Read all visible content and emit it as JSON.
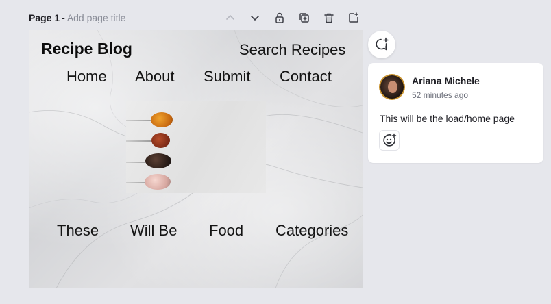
{
  "page": {
    "label": "Page 1",
    "separator": "-",
    "title_placeholder": "Add page title"
  },
  "toolbar": {
    "icons": [
      "chevron-up-icon",
      "chevron-down-icon",
      "lock-icon",
      "duplicate-page-icon",
      "trash-icon",
      "add-page-icon"
    ]
  },
  "design": {
    "blog_title": "Recipe Blog",
    "search": "Search Recipes",
    "nav": [
      "Home",
      "About",
      "Submit",
      "Contact"
    ],
    "categories": [
      "These",
      "Will Be",
      "Food",
      "Categories"
    ]
  },
  "comment": {
    "author": "Ariana Michele",
    "time": "52 minutes ago",
    "text": "This will be the load/home page"
  },
  "colors": {
    "background": "#e6e7ec",
    "avatar_ring": "#c7912e",
    "text": "#1e1e24",
    "muted": "#6d707b"
  }
}
